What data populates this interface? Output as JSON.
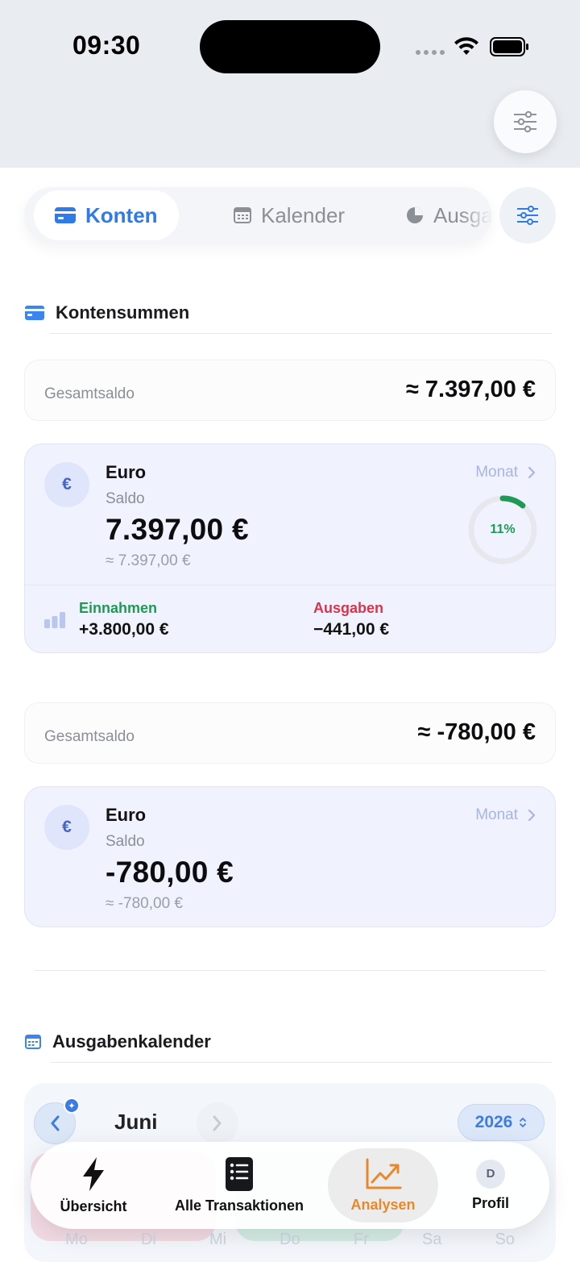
{
  "status_bar": {
    "time": "09:30"
  },
  "tabs": [
    {
      "label": "Konten",
      "icon": "card-icon",
      "active": true
    },
    {
      "label": "Kalender",
      "icon": "calendar-icon"
    },
    {
      "label": "Ausgaben",
      "icon": "pie-chart-icon"
    }
  ],
  "accounts_section": {
    "title": "Kontensummen",
    "groups": [
      {
        "total_label": "Gesamtsaldo",
        "total_value": "≈ 7.397,00 €",
        "account": {
          "symbol": "€",
          "name": "Euro",
          "subtitle": "Saldo",
          "balance": "7.397,00 €",
          "approx": "≈ 7.397,00 €",
          "period_link": "Monat",
          "progress_label": "11%",
          "progress_fraction": 0.11,
          "income_label": "Einnahmen",
          "income_value": "+3.800,00 €",
          "expense_label": "Ausgaben",
          "expense_value": "−441,00 €"
        }
      },
      {
        "total_label": "Gesamtsaldo",
        "total_value": "≈ -780,00 €",
        "account": {
          "symbol": "€",
          "name": "Euro",
          "subtitle": "Saldo",
          "balance": "-780,00 €",
          "approx": "≈ -780,00 €",
          "period_link": "Monat"
        }
      }
    ]
  },
  "calendar_section": {
    "title": "Ausgabenkalender",
    "month": "Juni",
    "year": "2026",
    "weekdays": [
      "Mo",
      "Di",
      "Mi",
      "Do",
      "Fr",
      "Sa",
      "So"
    ]
  },
  "bottom_nav": [
    {
      "label": "Übersicht",
      "icon": "lightning-icon"
    },
    {
      "label": "Alle Transaktionen",
      "icon": "list-icon"
    },
    {
      "label": "Analysen",
      "icon": "chart-trend-icon",
      "active": true
    },
    {
      "label": "Profil",
      "icon": "avatar",
      "initial": "D"
    }
  ],
  "colors": {
    "accent_blue": "#2f7be8",
    "income_green": "#1f9a55",
    "expense_red": "#d8344c",
    "active_orange": "#e7892b"
  }
}
